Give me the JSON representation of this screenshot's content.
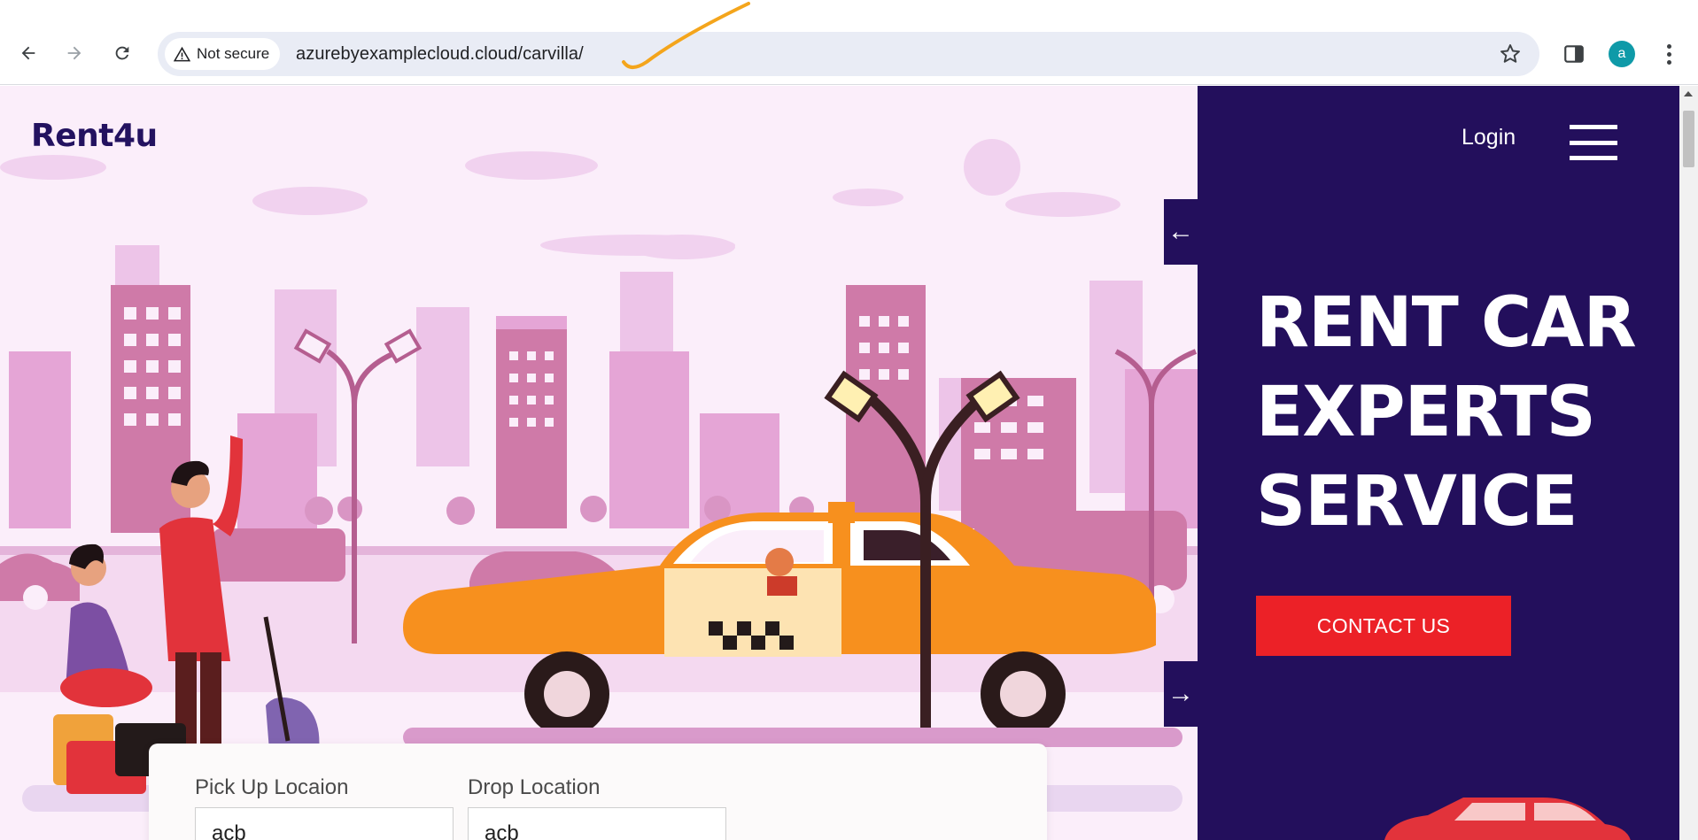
{
  "browser": {
    "security_label": "Not secure",
    "url": "azurebyexamplecloud.cloud/carvilla/",
    "profile_initial": "a",
    "icons": [
      "back-arrow-icon",
      "forward-arrow-icon",
      "reload-icon",
      "warning-triangle-icon",
      "star-bookmark-icon",
      "side-panel-icon",
      "kebab-menu-icon"
    ]
  },
  "site": {
    "brand": "Rent4u",
    "nav": {
      "login": "Login"
    },
    "hero": {
      "headline_lines": [
        "RENT CAR",
        "EXPERTS",
        "SERVICE"
      ],
      "cta": "CONTACT US"
    },
    "slider": {
      "prev_arrow": "←",
      "next_arrow": "→"
    },
    "booking": {
      "pickup_label": "Pick Up Locaion",
      "pickup_value": "acb",
      "drop_label": "Drop Location",
      "drop_value": "acb"
    }
  },
  "colors": {
    "panel": "#230f5c",
    "brand_text": "#231260",
    "cta": "#ec2127",
    "hero_bg": "#fbeefa",
    "taxi": "#f7901e"
  }
}
